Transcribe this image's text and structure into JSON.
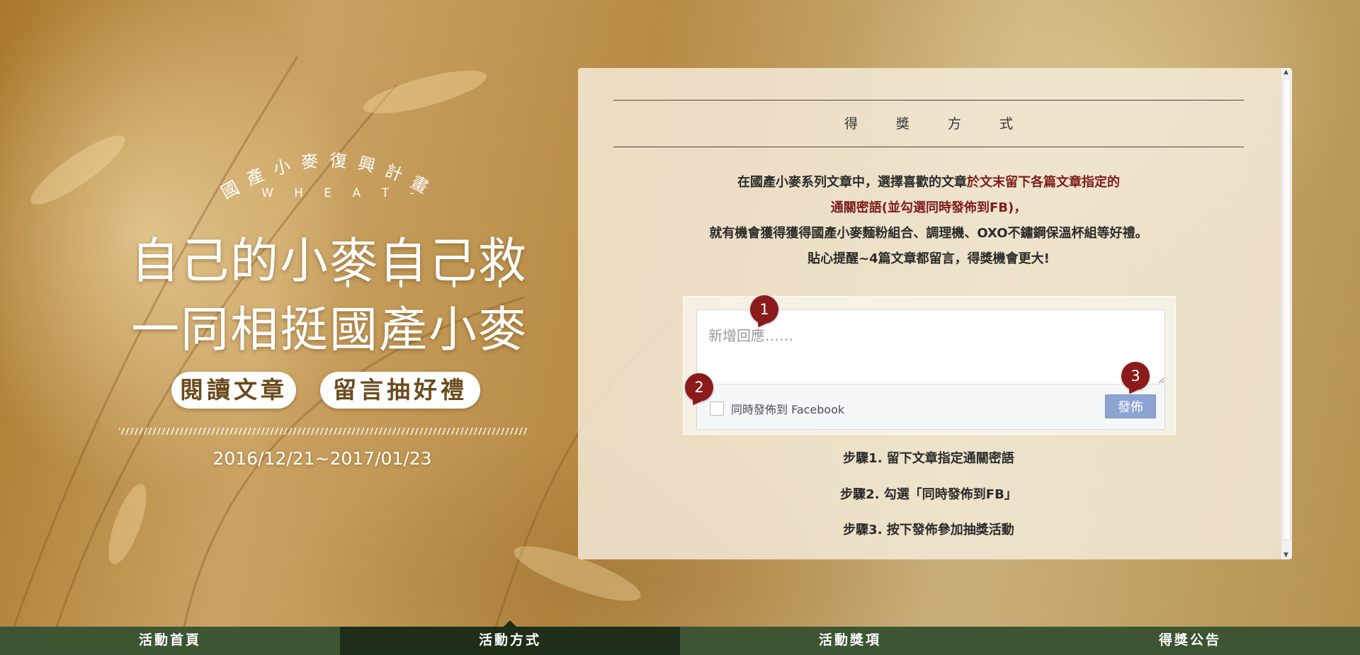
{
  "hero": {
    "arc_title": "國產小麥復興計畫",
    "subtitle": "- W H E A T -",
    "line1": "自己的小麥自己救",
    "line2": "一同相挺國產小麥",
    "pill_read": "閱讀文章",
    "pill_comment": "留言抽好禮",
    "date": "2016/12/21~2017/01/23"
  },
  "panel": {
    "heading": "得獎方式",
    "intro_line1_black": "在國產小麥系列文章中，選擇喜歡的文章",
    "intro_line1_red": "於文末留下各篇文章指定的",
    "intro_line2_red": "通關密語(並勾選同時發佈到FB)，",
    "intro_line3": "就有機會獲得獲得國產小麥麵粉組合、調理機、OXO不鏽鋼保溫杯組等好禮。",
    "intro_line4": "貼心提醒~4篇文章都留言，得獎機會更大!",
    "comment_box": {
      "placeholder": "新增回應……",
      "share_label": "同時發佈到 Facebook",
      "post_label": "發佈",
      "badge1": "1",
      "badge2": "2",
      "badge3": "3"
    },
    "steps": [
      "步驟1. 留下文章指定通關密語",
      "步驟2. 勾選「同時發佈到FB」",
      "步驟3. 按下發佈參加抽獎活動"
    ]
  },
  "nav": {
    "items": [
      "活動首頁",
      "活動方式",
      "活動獎項",
      "得獎公告"
    ],
    "active": "活動方式"
  },
  "colors": {
    "nav_bg": "#3e5533",
    "nav_active": "#1e2e18",
    "accent_red": "#7d1c1c",
    "badge": "#8b1a1a",
    "fb_button": "#8da4d3"
  }
}
